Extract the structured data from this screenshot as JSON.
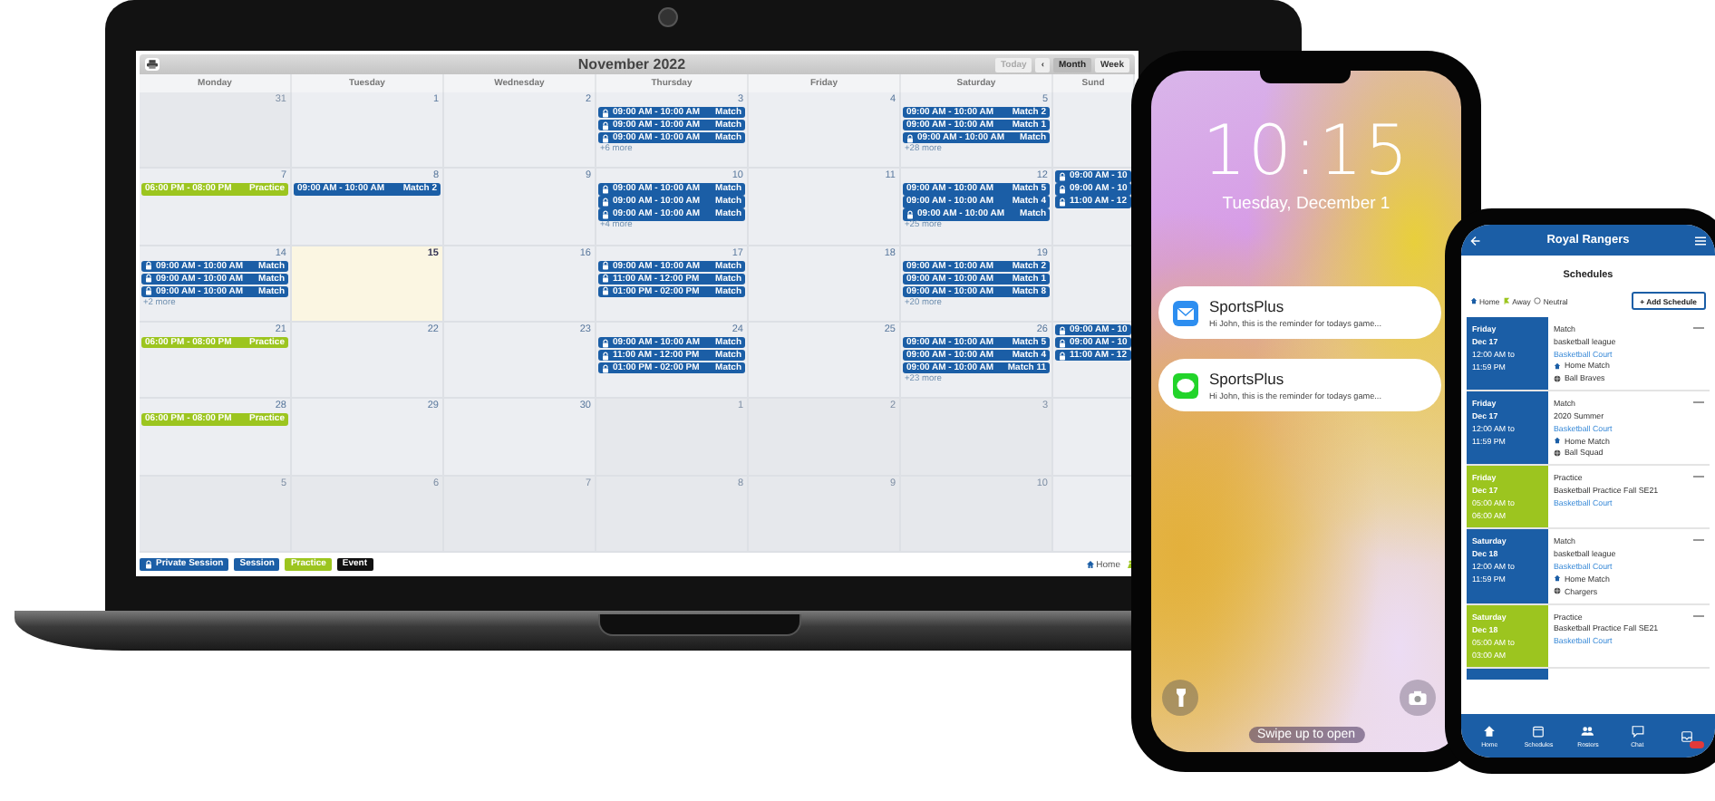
{
  "laptop": {
    "calendar": {
      "title": "November 2022",
      "nav": [
        {
          "label": "Today",
          "disabled": true
        },
        {
          "label": "‹",
          "disabled": false
        }
      ],
      "views": [
        {
          "label": "Month",
          "selected": true
        },
        {
          "label": "Week",
          "selected": false
        }
      ],
      "weekdays": [
        "Monday",
        "Tuesday",
        "Wednesday",
        "Thursday",
        "Friday",
        "Saturday",
        "Sund"
      ],
      "weeks": [
        {
          "days": [
            {
              "date": "31",
              "outside": true,
              "today": false
            },
            {
              "date": "1",
              "outside": false,
              "today": false
            },
            {
              "date": "2",
              "outside": false,
              "today": false
            },
            {
              "date": "3",
              "outside": false,
              "today": false,
              "events": [
                {
                  "kind": "private",
                  "time": "09:00 AM - 10:00 AM",
                  "title": "Match"
                },
                {
                  "kind": "private",
                  "time": "09:00 AM - 10:00 AM",
                  "title": "Match"
                },
                {
                  "kind": "private",
                  "time": "09:00 AM - 10:00 AM",
                  "title": "Match"
                }
              ],
              "more": "+6 more"
            },
            {
              "date": "4",
              "outside": false,
              "today": false
            },
            {
              "date": "5",
              "outside": false,
              "today": false,
              "events": [
                {
                  "kind": "session",
                  "time": "09:00 AM - 10:00 AM",
                  "title": "Match 2"
                },
                {
                  "kind": "session",
                  "time": "09:00 AM - 10:00 AM",
                  "title": "Match 1"
                },
                {
                  "kind": "private",
                  "time": "09:00 AM - 10:00 AM",
                  "title": "Match"
                }
              ],
              "more": "+28 more"
            },
            {
              "today": false
            }
          ]
        },
        {
          "days": [
            {
              "date": "7",
              "outside": false,
              "today": false,
              "events": [
                {
                  "kind": "practice",
                  "time": "06:00 PM - 08:00 PM",
                  "title": "Practice"
                }
              ]
            },
            {
              "date": "8",
              "outside": false,
              "today": false,
              "events": [
                {
                  "kind": "session",
                  "time": "09:00 AM - 10:00 AM",
                  "title": "Match 2"
                }
              ]
            },
            {
              "date": "9",
              "outside": false,
              "today": false
            },
            {
              "date": "10",
              "outside": false,
              "today": false,
              "events": [
                {
                  "kind": "private",
                  "time": "09:00 AM - 10:00 AM",
                  "title": "Match"
                },
                {
                  "kind": "private",
                  "time": "09:00 AM - 10:00 AM",
                  "title": "Match"
                },
                {
                  "kind": "private",
                  "time": "09:00 AM - 10:00 AM",
                  "title": "Match"
                }
              ],
              "more": "+4 more"
            },
            {
              "date": "11",
              "outside": false,
              "today": false
            },
            {
              "date": "12",
              "outside": false,
              "today": false,
              "events": [
                {
                  "kind": "session",
                  "time": "09:00 AM - 10:00 AM",
                  "title": "Match 5"
                },
                {
                  "kind": "session",
                  "time": "09:00 AM - 10:00 AM",
                  "title": "Match 4"
                },
                {
                  "kind": "private",
                  "time": "09:00 AM - 10:00 AM",
                  "title": "Match"
                }
              ],
              "more": "+25 more"
            },
            {
              "today": false,
              "events": [
                {
                  "kind": "private",
                  "time": "09:00 AM - 10"
                },
                {
                  "kind": "private",
                  "time": "09:00 AM - 10"
                },
                {
                  "kind": "private",
                  "time": "11:00 AM - 12"
                }
              ]
            }
          ]
        },
        {
          "days": [
            {
              "date": "14",
              "outside": false,
              "today": false,
              "events": [
                {
                  "kind": "private",
                  "time": "09:00 AM - 10:00 AM",
                  "title": "Match"
                },
                {
                  "kind": "private",
                  "time": "09:00 AM - 10:00 AM",
                  "title": "Match"
                },
                {
                  "kind": "private",
                  "time": "09:00 AM - 10:00 AM",
                  "title": "Match"
                }
              ],
              "more": "+2 more"
            },
            {
              "date": "15",
              "outside": false,
              "today": true
            },
            {
              "date": "16",
              "outside": false,
              "today": false
            },
            {
              "date": "17",
              "outside": false,
              "today": false,
              "events": [
                {
                  "kind": "private",
                  "time": "09:00 AM - 10:00 AM",
                  "title": "Match"
                },
                {
                  "kind": "private",
                  "time": "11:00 AM - 12:00 PM",
                  "title": "Match"
                },
                {
                  "kind": "private",
                  "time": "01:00 PM - 02:00 PM",
                  "title": "Match"
                }
              ]
            },
            {
              "date": "18",
              "outside": false,
              "today": false
            },
            {
              "date": "19",
              "outside": false,
              "today": false,
              "events": [
                {
                  "kind": "session",
                  "time": "09:00 AM - 10:00 AM",
                  "title": "Match 2"
                },
                {
                  "kind": "session",
                  "time": "09:00 AM - 10:00 AM",
                  "title": "Match 1"
                },
                {
                  "kind": "session",
                  "time": "09:00 AM - 10:00 AM",
                  "title": "Match 8"
                }
              ],
              "more": "+20 more"
            },
            {
              "today": false
            }
          ]
        },
        {
          "days": [
            {
              "date": "21",
              "outside": false,
              "today": false,
              "events": [
                {
                  "kind": "practice",
                  "time": "06:00 PM - 08:00 PM",
                  "title": "Practice"
                }
              ]
            },
            {
              "date": "22",
              "outside": false,
              "today": false
            },
            {
              "date": "23",
              "outside": false,
              "today": false
            },
            {
              "date": "24",
              "outside": false,
              "today": false,
              "events": [
                {
                  "kind": "private",
                  "time": "09:00 AM - 10:00 AM",
                  "title": "Match"
                },
                {
                  "kind": "private",
                  "time": "11:00 AM - 12:00 PM",
                  "title": "Match"
                },
                {
                  "kind": "private",
                  "time": "01:00 PM - 02:00 PM",
                  "title": "Match"
                }
              ]
            },
            {
              "date": "25",
              "outside": false,
              "today": false
            },
            {
              "date": "26",
              "outside": false,
              "today": false,
              "events": [
                {
                  "kind": "session",
                  "time": "09:00 AM - 10:00 AM",
                  "title": "Match 5"
                },
                {
                  "kind": "session",
                  "time": "09:00 AM - 10:00 AM",
                  "title": "Match 4"
                },
                {
                  "kind": "session",
                  "time": "09:00 AM - 10:00 AM",
                  "title": "Match 11"
                }
              ],
              "more": "+23 more"
            },
            {
              "today": false,
              "events": [
                {
                  "kind": "private",
                  "time": "09:00 AM - 10"
                },
                {
                  "kind": "private",
                  "time": "09:00 AM - 10"
                },
                {
                  "kind": "private",
                  "time": "11:00 AM - 12"
                }
              ]
            }
          ]
        },
        {
          "days": [
            {
              "date": "28",
              "outside": false,
              "today": false,
              "events": [
                {
                  "kind": "practice",
                  "time": "06:00 PM - 08:00 PM",
                  "title": "Practice"
                }
              ]
            },
            {
              "date": "29",
              "outside": false,
              "today": false
            },
            {
              "date": "30",
              "outside": false,
              "today": false
            },
            {
              "date": "1",
              "outside": true,
              "today": false
            },
            {
              "date": "2",
              "outside": true,
              "today": false
            },
            {
              "date": "3",
              "outside": true,
              "today": false
            },
            {
              "today": false
            }
          ]
        },
        {
          "days": [
            {
              "date": "5",
              "outside": true,
              "today": false
            },
            {
              "date": "6",
              "outside": true,
              "today": false
            },
            {
              "date": "7",
              "outside": true,
              "today": false
            },
            {
              "date": "8",
              "outside": true,
              "today": false
            },
            {
              "date": "9",
              "outside": true,
              "today": false
            },
            {
              "date": "10",
              "outside": true,
              "today": false
            },
            {
              "today": false
            }
          ]
        }
      ],
      "legend": [
        {
          "kind": "private",
          "label": "Private Session"
        },
        {
          "kind": "session",
          "label": "Session"
        },
        {
          "kind": "practice",
          "label": "Practice"
        },
        {
          "kind": "event",
          "label": "Event"
        }
      ],
      "footer_link": "Home"
    }
  },
  "lock_phone": {
    "time": "10:15",
    "date": "Tuesday, December 1",
    "notifications": [
      {
        "kind": "mail",
        "app": "SportsPlus",
        "text": "Hi John, this is the reminder for todays game..."
      },
      {
        "kind": "message",
        "app": "SportsPlus",
        "text": "Hi John, this is the reminder for todays game..."
      }
    ],
    "hint": "Swipe up to open"
  },
  "app_phone": {
    "title": "Royal Rangers",
    "heading": "Schedules",
    "legend": [
      {
        "kind": "home",
        "label": "Home"
      },
      {
        "kind": "away",
        "label": "Away"
      },
      {
        "kind": "neutral",
        "label": "Neutral"
      }
    ],
    "add_button": "+ Add Schedule",
    "schedules": [
      {
        "kind": "match",
        "day": "Friday",
        "date": "Dec 17",
        "start": "12:00 AM to",
        "end": "11:59 PM",
        "type": "Match",
        "name": "basketball league",
        "location": "Basketball Court",
        "venue": "Home Match",
        "opponent": "Ball Braves"
      },
      {
        "kind": "match",
        "day": "Friday",
        "date": "Dec 17",
        "start": "12:00 AM to",
        "end": "11:59 PM",
        "type": "Match",
        "name": "2020 Summer",
        "location": "Basketball Court",
        "venue": "Home Match",
        "opponent": "Ball Squad"
      },
      {
        "kind": "practice",
        "day": "Friday",
        "date": "Dec 17",
        "start": "05:00 AM to",
        "end": "06:00 AM",
        "type": "Practice",
        "name": "Basketball Practice Fall SE21",
        "location": "Basketball Court"
      },
      {
        "kind": "match",
        "day": "Saturday",
        "date": "Dec 18",
        "start": "12:00 AM to",
        "end": "11:59 PM",
        "type": "Match",
        "name": "basketball league",
        "location": "Basketball Court",
        "venue": "Home Match",
        "opponent": "Chargers"
      },
      {
        "kind": "practice",
        "day": "Saturday",
        "date": "Dec 18",
        "start": "05:00 AM to",
        "end": "03:00 AM",
        "type": "Practice",
        "name": "Basketball Practice Fall SE21",
        "location": "Basketball Court"
      },
      {
        "kind": "match"
      }
    ],
    "nav": [
      {
        "kind": "home",
        "label": "Home"
      },
      {
        "kind": "schedules",
        "label": "Schedules"
      },
      {
        "kind": "rosters",
        "label": "Rosters"
      },
      {
        "kind": "chat",
        "label": "Chat"
      },
      {
        "kind": "inbox"
      }
    ]
  }
}
